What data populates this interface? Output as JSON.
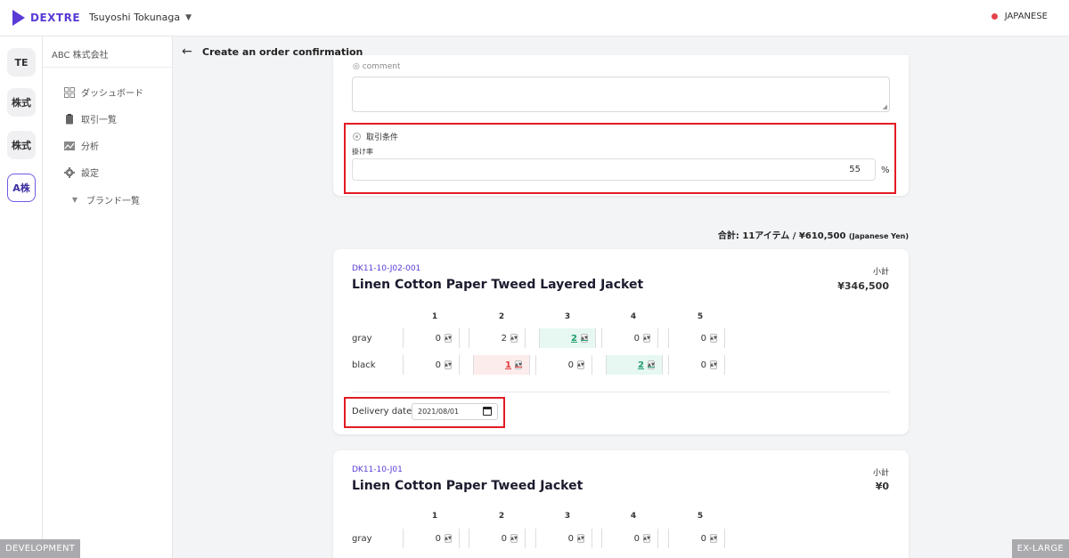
{
  "header": {
    "logo_text": "DEXTRE",
    "user_name": "Tsuyoshi Tokunaga",
    "language": "JAPANESE"
  },
  "rail": {
    "items": [
      "TE",
      "株式",
      "株式",
      "A株"
    ]
  },
  "sidebar": {
    "company": "ABC 株式会社",
    "items": [
      {
        "label": "ダッシュボード",
        "icon": "dashboard-icon"
      },
      {
        "label": "取引一覧",
        "icon": "clipboard-icon"
      },
      {
        "label": "分析",
        "icon": "chart-icon"
      },
      {
        "label": "設定",
        "icon": "gear-icon"
      },
      {
        "label": "ブランド一覧",
        "icon": "caret-down-icon"
      }
    ]
  },
  "page": {
    "title": "Create an order confirmation"
  },
  "terms": {
    "label": "取引条件",
    "rate_label": "掛け率",
    "rate_value": "55",
    "rate_unit": "%"
  },
  "summary": {
    "total_text": "合計:  11アイテム / ¥610,500",
    "currency_note": "(Japanese Yen)"
  },
  "products": [
    {
      "code": "DK11-10-J02-001",
      "name": "Linen Cotton Paper Tweed Layered Jacket",
      "subtotal_label": "小計",
      "subtotal": "¥346,500",
      "sizes": [
        "1",
        "2",
        "3",
        "4",
        "5"
      ],
      "rows": [
        {
          "color": "gray",
          "qty": [
            "0",
            "2",
            "2",
            "0",
            "0"
          ]
        },
        {
          "color": "black",
          "qty": [
            "0",
            "1",
            "0",
            "2",
            "0"
          ]
        }
      ],
      "delivery_label": "Delivery date",
      "delivery_date": "2021/08/01"
    },
    {
      "code": "DK11-10-J01",
      "name": "Linen Cotton Paper Tweed Jacket",
      "subtotal_label": "小計",
      "subtotal": "¥0",
      "sizes": [
        "1",
        "2",
        "3",
        "4",
        "5"
      ],
      "rows": [
        {
          "color": "gray",
          "qty": [
            "0",
            "0",
            "0",
            "0",
            "0"
          ]
        }
      ]
    }
  ],
  "env": {
    "left": "DEVELOPMENT",
    "right": "EX-LARGE"
  }
}
